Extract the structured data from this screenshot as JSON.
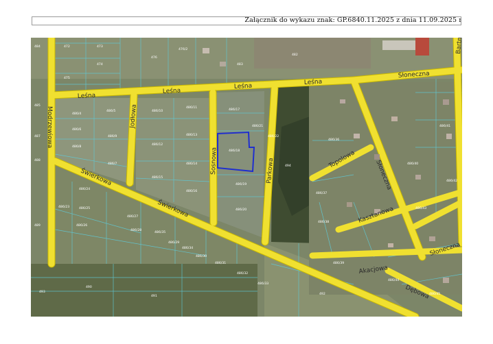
{
  "header": {
    "text": "Załącznik do wykazu znak: GP.6840.11.2025 z dnia 11.09.2025 r."
  },
  "map": {
    "colors": {
      "road": "#f0e030",
      "road_edge": "#c9b800",
      "parcel_line": "#5fc9d6",
      "highlight": "#1f2fcf",
      "field": "#86907a",
      "field_dark": "#6f7760",
      "forest": "#3d4a2f"
    },
    "streets": {
      "lesna_1": "Leśna",
      "lesna_2": "Leśna",
      "lesna_3": "Leśna",
      "lesna_4": "Leśna",
      "sloneczna_1": "Słoneczna",
      "sloneczna_2": "Słoneczna",
      "sloneczna_3": "Słoneczna",
      "modrzewiowa": "Modrzewiowa",
      "jodlowa": "Jodłowa",
      "sosnowa": "Sosnowa",
      "parkowa": "Parkowa",
      "swierkowa_1": "Świerkowa",
      "swierkowa_2": "Świerkowa",
      "topolowa": "Topolowa",
      "kasztanowa": "Kasztanowa",
      "akacjowa": "Akacjowa",
      "debowa": "Dębowa",
      "bartna": "Bartna"
    },
    "parcels": {
      "p01": "486/4",
      "p02": "486/5",
      "p03": "486/6",
      "p04": "486/9",
      "p05": "486/8",
      "p06": "486/7",
      "p07": "486/10",
      "p08": "486/11",
      "p09": "486/12",
      "p10": "486/13",
      "p11": "486/14",
      "p12": "486/15",
      "p13": "486/16",
      "p14": "486/17",
      "p15": "486/18",
      "p16": "486/19",
      "p17": "486/20",
      "p18": "486/21",
      "p19": "486/22",
      "p20": "486/23",
      "p21": "486/24",
      "p22": "486/25",
      "p23": "486/26",
      "p24": "486/27",
      "p25": "486/28",
      "p26": "486/29",
      "p27": "486/30",
      "p28": "486/31",
      "p29": "486/32",
      "p30": "486/33",
      "p31": "486/34",
      "p32": "486/35",
      "p33": "486/36",
      "p34": "486/37",
      "p35": "486/38",
      "p36": "486/39",
      "p37": "486/40",
      "p38": "486/41",
      "p39": "486/42",
      "p40": "486/43",
      "p41": "486/44",
      "p42": "486/45",
      "p43": "472",
      "p44": "473",
      "p45": "474",
      "p46": "475",
      "p47": "476",
      "p48": "476/2",
      "p49": "482",
      "p50": "483",
      "p51": "484",
      "p52": "485",
      "p53": "487",
      "p54": "488",
      "p55": "489",
      "p56": "490",
      "p57": "491",
      "p58": "492",
      "p59": "493",
      "p60": "494"
    }
  }
}
